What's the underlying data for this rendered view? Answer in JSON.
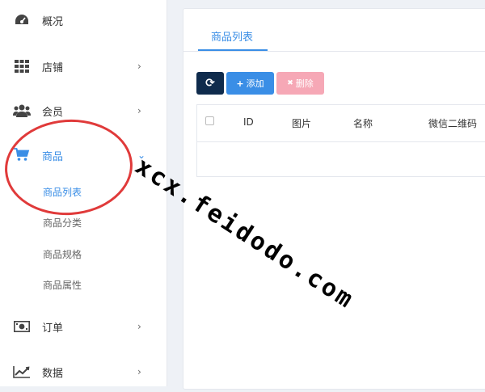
{
  "sidebar": {
    "items": [
      {
        "label": "概况",
        "icon": "dashboard-icon",
        "has_chevron": false
      },
      {
        "label": "店铺",
        "icon": "grid-icon",
        "has_chevron": true
      },
      {
        "label": "会员",
        "icon": "users-icon",
        "has_chevron": true
      },
      {
        "label": "商品",
        "icon": "cart-icon",
        "has_chevron": true,
        "expanded": true,
        "active": true
      },
      {
        "label": "订单",
        "icon": "money-icon",
        "has_chevron": true
      },
      {
        "label": "数据",
        "icon": "chart-line-icon",
        "has_chevron": true
      }
    ],
    "chevron_right": "›",
    "chevron_down": "⌄",
    "sub_items": [
      {
        "label": "商品列表",
        "active": true
      },
      {
        "label": "商品分类"
      },
      {
        "label": "商品规格"
      },
      {
        "label": "商品属性"
      }
    ]
  },
  "main": {
    "tab_label": "商品列表",
    "buttons": {
      "refresh_glyph": "⟳",
      "add_glyph": "+",
      "add_label": "添加",
      "delete_glyph": "✖",
      "delete_label": "删除"
    },
    "table": {
      "headers": [
        "ID",
        "图片",
        "名称",
        "微信二维码"
      ]
    }
  },
  "watermark": "xcx.feidodo.com",
  "colors": {
    "accent": "#3a8ee6",
    "refresh_button": "#0f2b4c",
    "delete_button": "#f6a8b6",
    "annotation_circle": "#e03a3a"
  }
}
